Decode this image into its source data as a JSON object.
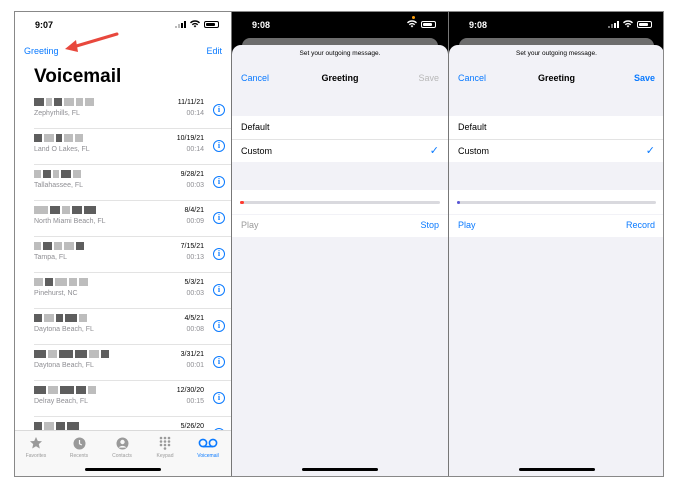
{
  "accent_color": "#0a7aff",
  "voicemail_screen": {
    "status_time": "9:07",
    "greeting_link": "Greeting",
    "edit_link": "Edit",
    "title": "Voicemail",
    "rows": [
      {
        "location": "Zephyrhills, FL",
        "date": "11/11/21",
        "duration": "00:14"
      },
      {
        "location": "Land O Lakes, FL",
        "date": "10/19/21",
        "duration": "00:14"
      },
      {
        "location": "Tallahassee, FL",
        "date": "9/28/21",
        "duration": "00:03"
      },
      {
        "location": "North Miami Beach, FL",
        "date": "8/4/21",
        "duration": "00:09"
      },
      {
        "location": "Tampa, FL",
        "date": "7/15/21",
        "duration": "00:13"
      },
      {
        "location": "Pinehurst, NC",
        "date": "5/3/21",
        "duration": "00:03"
      },
      {
        "location": "Daytona Beach, FL",
        "date": "4/5/21",
        "duration": "00:08"
      },
      {
        "location": "Daytona Beach, FL",
        "date": "3/31/21",
        "duration": "00:01"
      },
      {
        "location": "Delray Beach, FL",
        "date": "12/30/20",
        "duration": "00:15"
      },
      {
        "location": "",
        "date": "5/26/20",
        "duration": ""
      }
    ],
    "tabs": [
      {
        "label": "Favorites",
        "icon": "star-icon"
      },
      {
        "label": "Recents",
        "icon": "clock-icon"
      },
      {
        "label": "Contacts",
        "icon": "person-circle-icon"
      },
      {
        "label": "Keypad",
        "icon": "keypad-icon"
      },
      {
        "label": "Voicemail",
        "icon": "voicemail-icon",
        "active": true
      }
    ]
  },
  "recording_screen": {
    "status_time": "9:08",
    "prompt": "Set your outgoing message.",
    "cancel": "Cancel",
    "title": "Greeting",
    "save": "Save",
    "options": [
      "Default",
      "Custom"
    ],
    "selected": "Custom",
    "progress_fraction": 0.02,
    "progress_color": "#ff3b30",
    "play": "Play",
    "action": "Stop"
  },
  "recorded_screen": {
    "status_time": "9:08",
    "prompt": "Set your outgoing message.",
    "cancel": "Cancel",
    "title": "Greeting",
    "save": "Save",
    "options": [
      "Default",
      "Custom"
    ],
    "selected": "Custom",
    "progress_fraction": 0.01,
    "progress_color": "#5856d6",
    "play": "Play",
    "action": "Record"
  }
}
